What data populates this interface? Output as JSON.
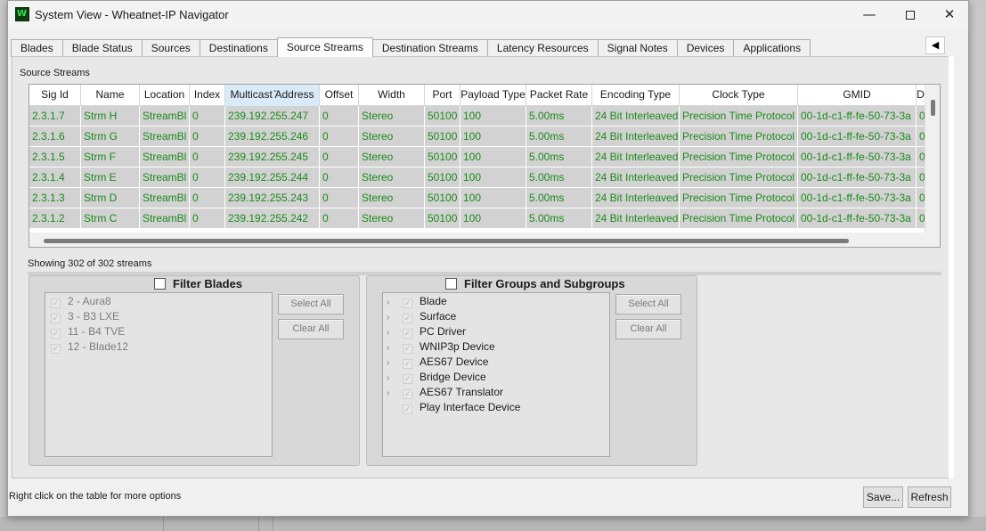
{
  "window": {
    "icon_letter": "W",
    "title": "System View - Wheatnet-IP Navigator",
    "min_glyph": "—",
    "close_glyph": "✕"
  },
  "tabs": [
    {
      "label": "Blades",
      "active": false
    },
    {
      "label": "Blade Status",
      "active": false
    },
    {
      "label": "Sources",
      "active": false
    },
    {
      "label": "Destinations",
      "active": false
    },
    {
      "label": "Source Streams",
      "active": true
    },
    {
      "label": "Destination Streams",
      "active": false
    },
    {
      "label": "Latency Resources",
      "active": false
    },
    {
      "label": "Signal Notes",
      "active": false
    },
    {
      "label": "Devices",
      "active": false
    },
    {
      "label": "Applications",
      "active": false
    }
  ],
  "tab_scroll_glyph": "◀",
  "section_label": "Source Streams",
  "table": {
    "columns": [
      "Sig Id",
      "Name",
      "Location",
      "Index",
      "Multicast Address",
      "Offset",
      "Width",
      "Port",
      "Payload Type",
      "Packet Rate",
      "Encoding Type",
      "Clock Type",
      "GMID",
      "D"
    ],
    "sorted_column": "Multicast Address",
    "rows": [
      [
        "2.3.1.7",
        "Strm H",
        "StreamBl",
        "0",
        "239.192.255.247",
        "0",
        "Stereo",
        "50100",
        "100",
        "5.00ms",
        "24 Bit Interleaved",
        "Precision Time Protocol",
        "00-1d-c1-ff-fe-50-73-3a",
        "0"
      ],
      [
        "2.3.1.6",
        "Strm G",
        "StreamBl",
        "0",
        "239.192.255.246",
        "0",
        "Stereo",
        "50100",
        "100",
        "5.00ms",
        "24 Bit Interleaved",
        "Precision Time Protocol",
        "00-1d-c1-ff-fe-50-73-3a",
        "0"
      ],
      [
        "2.3.1.5",
        "Strm F",
        "StreamBl",
        "0",
        "239.192.255.245",
        "0",
        "Stereo",
        "50100",
        "100",
        "5.00ms",
        "24 Bit Interleaved",
        "Precision Time Protocol",
        "00-1d-c1-ff-fe-50-73-3a",
        "0"
      ],
      [
        "2.3.1.4",
        "Strm E",
        "StreamBl",
        "0",
        "239.192.255.244",
        "0",
        "Stereo",
        "50100",
        "100",
        "5.00ms",
        "24 Bit Interleaved",
        "Precision Time Protocol",
        "00-1d-c1-ff-fe-50-73-3a",
        "0"
      ],
      [
        "2.3.1.3",
        "Strm D",
        "StreamBl",
        "0",
        "239.192.255.243",
        "0",
        "Stereo",
        "50100",
        "100",
        "5.00ms",
        "24 Bit Interleaved",
        "Precision Time Protocol",
        "00-1d-c1-ff-fe-50-73-3a",
        "0"
      ],
      [
        "2.3.1.2",
        "Strm C",
        "StreamBl",
        "0",
        "239.192.255.242",
        "0",
        "Stereo",
        "50100",
        "100",
        "5.00ms",
        "24 Bit Interleaved",
        "Precision Time Protocol",
        "00-1d-c1-ff-fe-50-73-3a",
        "0"
      ]
    ]
  },
  "colors": {
    "row_text": "#1a8a1a",
    "row_bg": "#d2d2d2",
    "sorted_header": "#d9ebf9"
  },
  "status_line": "Showing 302 of 302 streams",
  "filter_blades": {
    "title": "Filter Blades",
    "items": [
      "2 - Aura8",
      "3 - B3 LXE",
      "11 - B4 TVE",
      "12 - Blade12"
    ],
    "select_all": "Select All",
    "clear_all": "Clear All"
  },
  "filter_groups": {
    "title": "Filter Groups and Subgroups",
    "items": [
      {
        "label": "Blade",
        "expandable": true
      },
      {
        "label": "Surface",
        "expandable": true
      },
      {
        "label": "PC Driver",
        "expandable": true
      },
      {
        "label": "WNIP3p Device",
        "expandable": true
      },
      {
        "label": "AES67 Device",
        "expandable": true
      },
      {
        "label": "Bridge Device",
        "expandable": true
      },
      {
        "label": "AES67 Translator",
        "expandable": true
      },
      {
        "label": "Play Interface Device",
        "expandable": false
      }
    ],
    "select_all": "Select All",
    "clear_all": "Clear All"
  },
  "footer": {
    "hint": "Right click on the table for more options",
    "save": "Save...",
    "refresh": "Refresh"
  }
}
